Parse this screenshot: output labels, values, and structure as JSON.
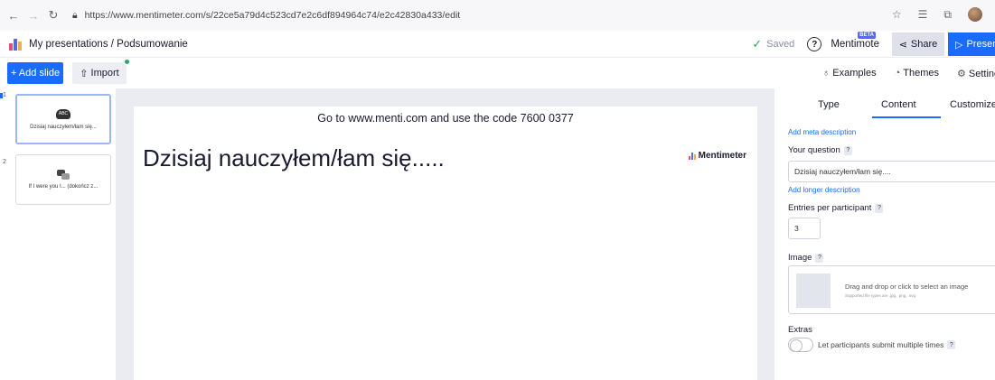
{
  "browser": {
    "url": "https://www.mentimeter.com/s/22ce5a79d4c523cd7e2c6df894964c74/e2c42830a433/edit"
  },
  "appbar": {
    "breadcrumb": "My presentations / Podsumowanie",
    "saved_label": "Saved",
    "mentimote_label": "Mentimote",
    "beta_badge": "BETA",
    "share_label": "Share",
    "present_label": "Present"
  },
  "toolbar": {
    "add_slide_label": "+ Add slide",
    "import_label": "Import",
    "examples_label": "Examples",
    "themes_label": "Themes",
    "settings_label": "Settings"
  },
  "slides": [
    {
      "number": "1",
      "label": "Dzisiaj nauczyłem/łam się...",
      "icon": "word-cloud-icon",
      "icon_text": "ABC"
    },
    {
      "number": "2",
      "label": "If I were you I... (dokończ z...",
      "icon": "open-ended-icon"
    }
  ],
  "slide": {
    "instruction_prefix": "Go to www.menti.com and use the code",
    "code": "7600 0377",
    "question": "Dzisiaj nauczyłem/łam się.....",
    "brand": "Mentimeter"
  },
  "panel": {
    "tabs": [
      "Type",
      "Content",
      "Customize"
    ],
    "active_tab": "Content",
    "add_meta": "Add meta description",
    "your_question_label": "Your question",
    "question_value": "Dzisiaj nauczyłem/łam się....",
    "add_longer": "Add longer description",
    "entries_label": "Entries per participant",
    "entries_value": "3",
    "image_label": "Image",
    "drop_text": "Drag and drop or click to select an image",
    "supported_text": "Supported file types are .jpg, .png, .svg",
    "extras_label": "Extras",
    "toggle_label": "Let participants submit multiple times",
    "help_mark": "?"
  },
  "colors": {
    "accent": "#196cff",
    "success": "#2ea44f"
  }
}
